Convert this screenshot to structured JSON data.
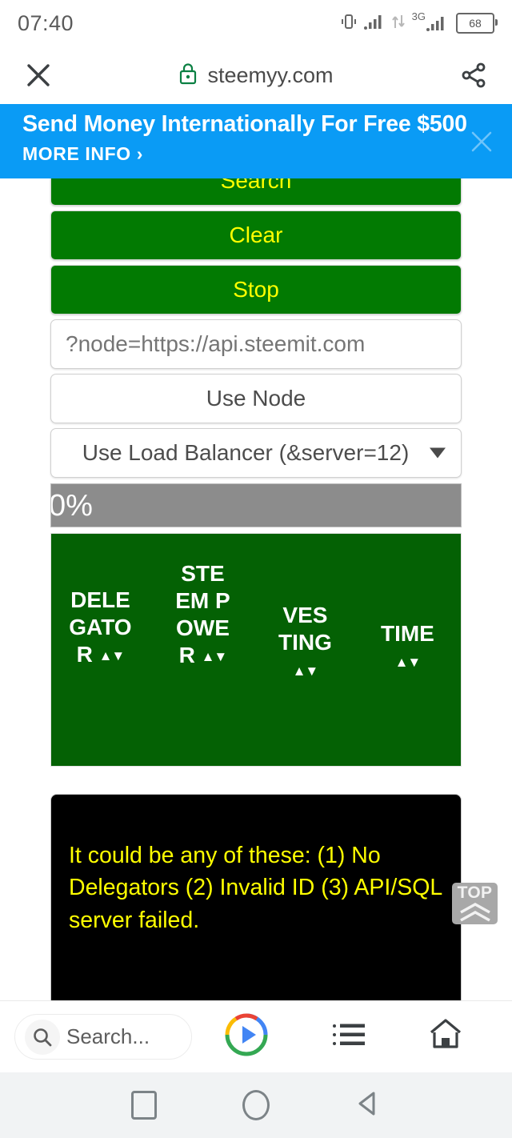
{
  "status_bar": {
    "time": "07:40",
    "battery_level": "68",
    "network_type": "3G",
    "icons": [
      "vibrate-icon",
      "signal-bars-icon",
      "data-transfer-icon",
      "network-3g-icon",
      "battery-icon"
    ]
  },
  "browser_bar": {
    "url": "steemyy.com",
    "close_label": "×",
    "lock_icon": "lock-icon",
    "share_icon": "share-icon"
  },
  "ad_banner": {
    "title": "Send Money Internationally For Free $500",
    "cta": "MORE INFO ›",
    "close_label": "×",
    "bg_color": "#0a9bf5"
  },
  "form": {
    "search_button": "Search",
    "clear_button": "Clear",
    "stop_button": "Stop",
    "node_placeholder": "?node=https://api.steemit.com",
    "node_value": "",
    "use_node_button": "Use Node",
    "load_balancer_selected": "Use Load Balancer (&server=12)",
    "button_bg": "#027a02",
    "button_text_color": "#ffff00"
  },
  "progress": {
    "label": "0%",
    "percent": 0,
    "bg_color": "#8c8c8c"
  },
  "table": {
    "header_bg": "#046104",
    "sort_arrows": "▲▼",
    "columns": [
      {
        "label": "DELEGATOR",
        "sortable": true
      },
      {
        "label": "STEEM POWER",
        "sortable": true
      },
      {
        "label": "VESTING",
        "sortable": true
      },
      {
        "label": "TIME",
        "sortable": true
      }
    ]
  },
  "message_panel": {
    "text": "It could be any of these: (1) No Delegators (2) Invalid ID (3) API/SQL server failed.",
    "bg_color": "#000000",
    "text_color": "#ffff00"
  },
  "top_button": {
    "label": "TOP",
    "icon": "double-chevron-up-icon"
  },
  "bottom_toolbar": {
    "search_placeholder": "Search...",
    "search_icon": "search-icon",
    "play_icon": "google-play-icon",
    "list_icon": "list-icon",
    "home_icon": "home-icon"
  },
  "android_nav": {
    "recents_icon": "square-recents-icon",
    "home_icon": "circle-home-icon",
    "back_icon": "triangle-back-icon"
  }
}
